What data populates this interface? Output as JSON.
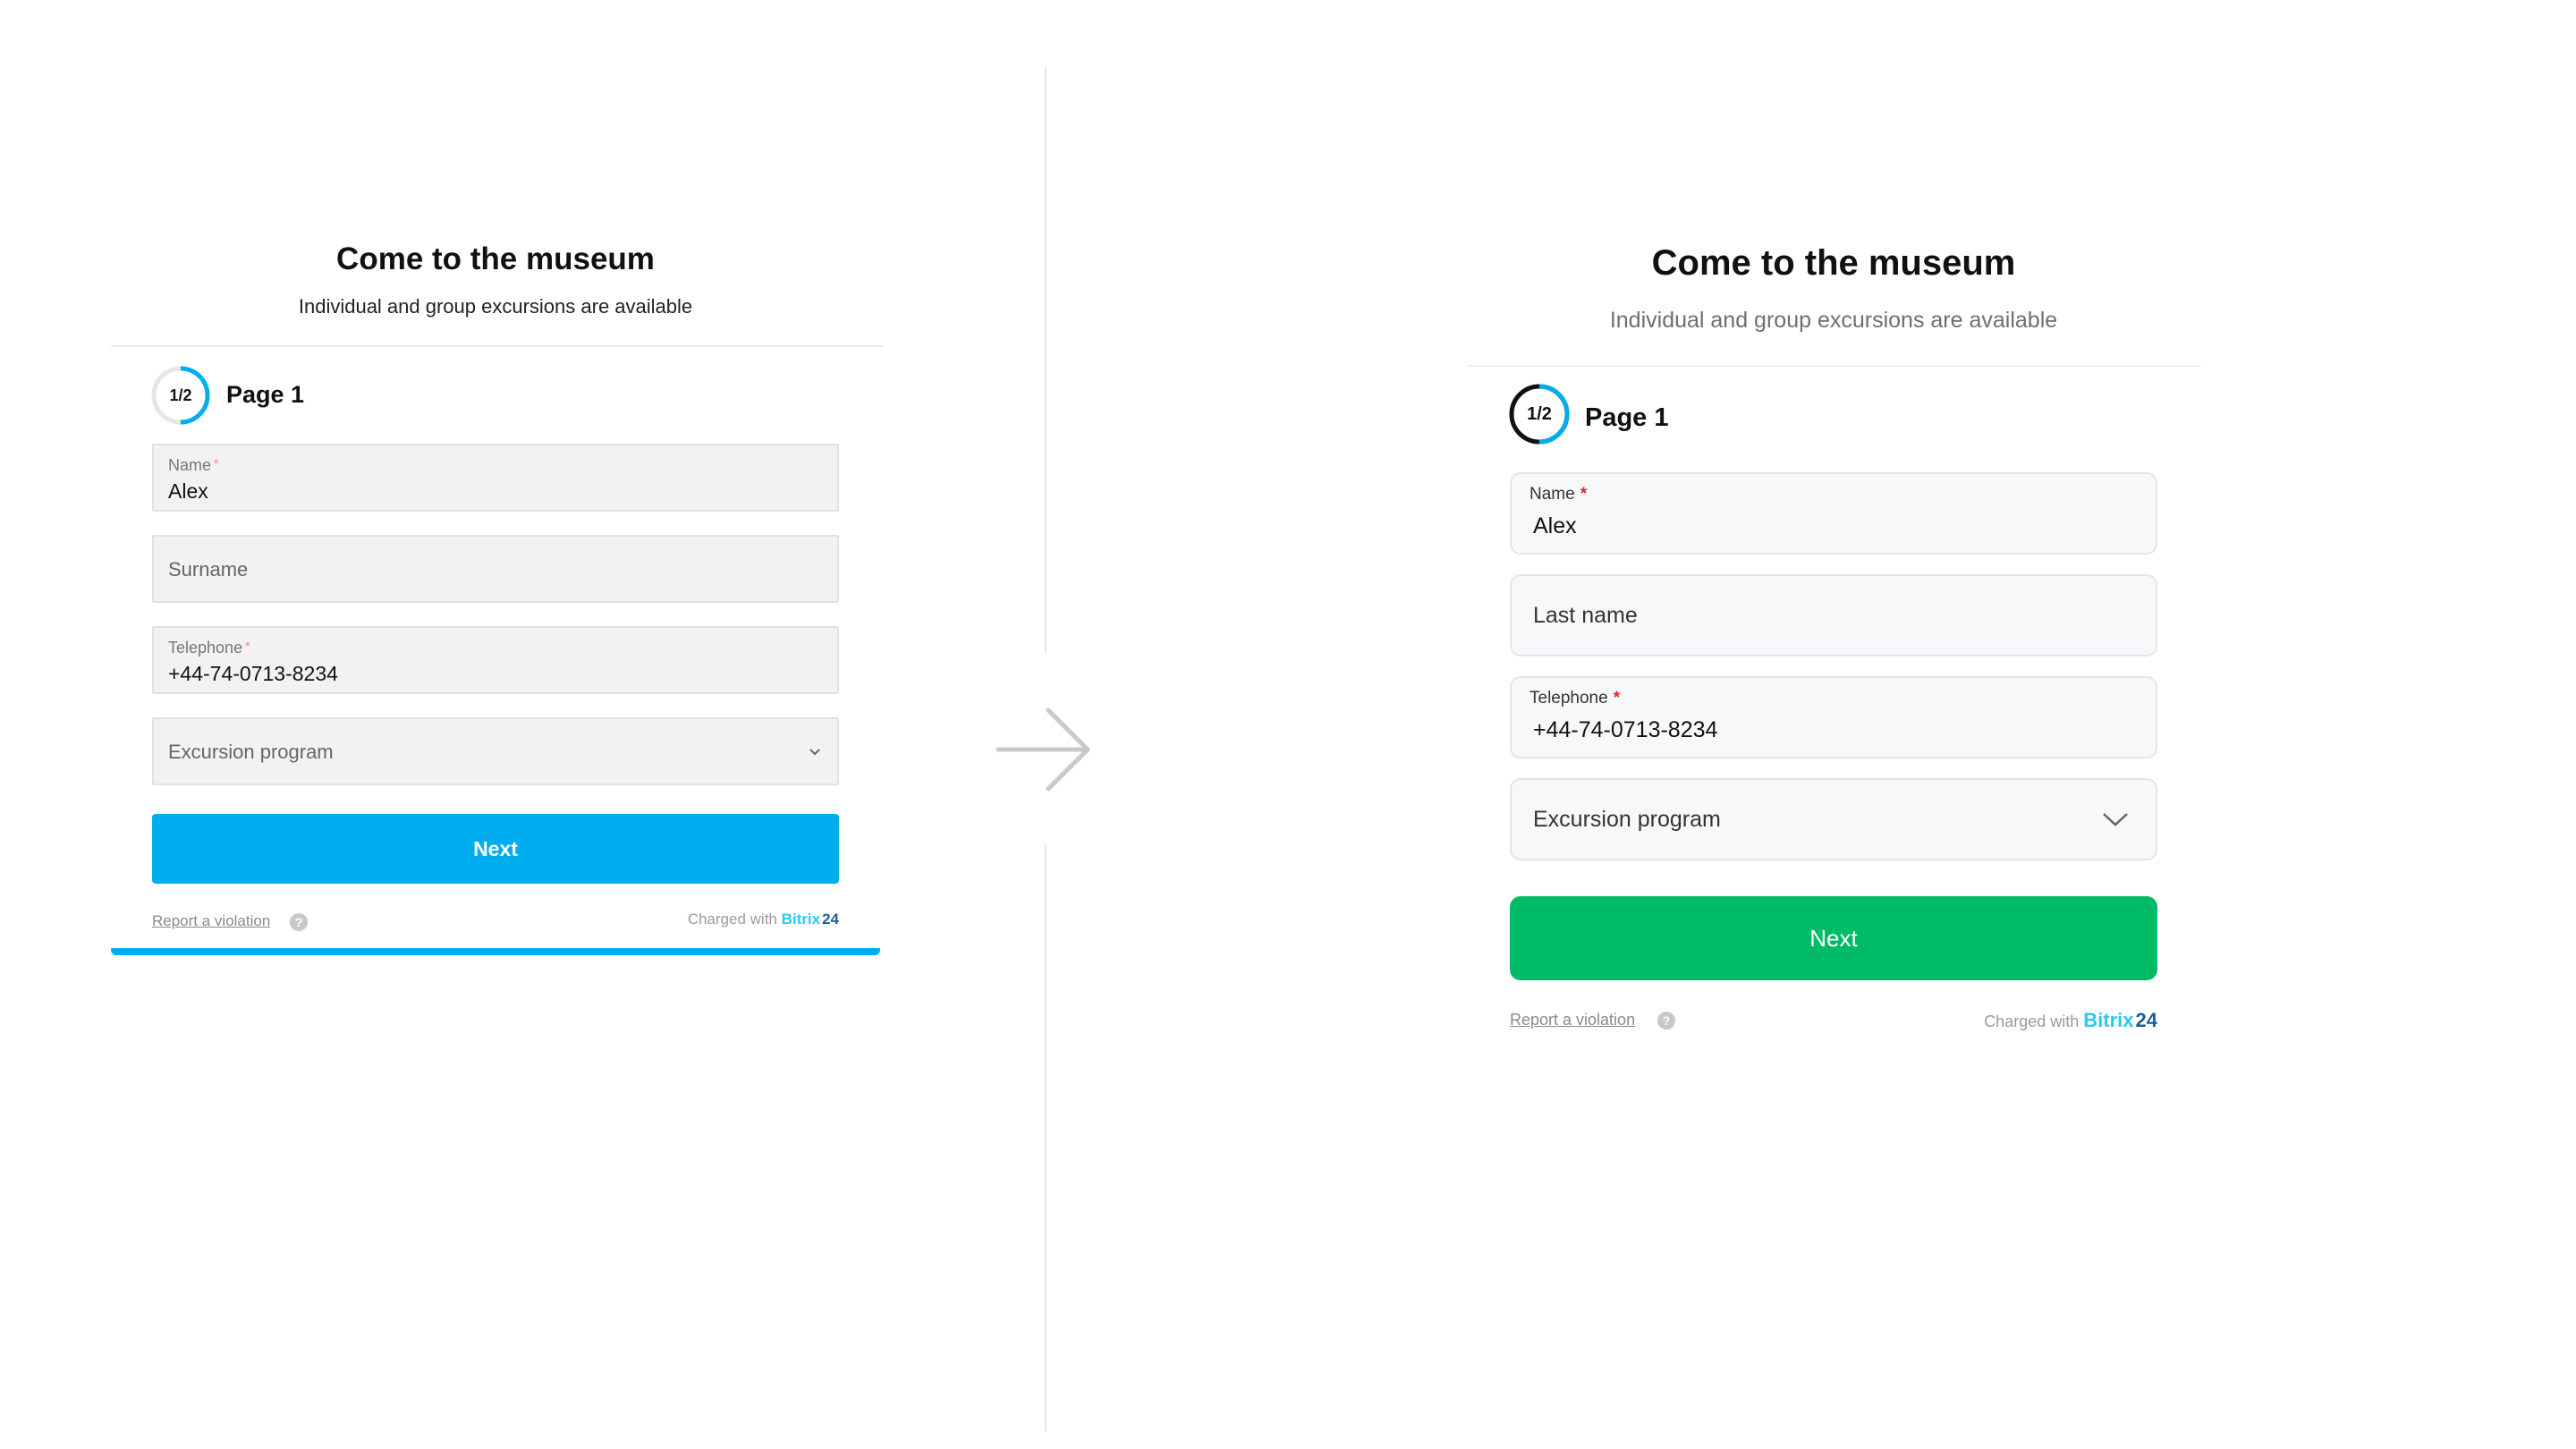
{
  "colors": {
    "old_accent": "#00aef0",
    "new_accent": "#00bb65",
    "progress_blue": "#00aef0",
    "bitrix_brand": "#2fc6f6",
    "bitrix_24": "#1c5e9c",
    "required_mark_new": "#e0262b"
  },
  "comparison": {
    "arrow_icon": "arrow-right-icon"
  },
  "old_form": {
    "title": "Come to the museum",
    "subtitle": "Individual and group excursions are available",
    "progress": {
      "text": "1/2",
      "fraction": 0.5
    },
    "page_label": "Page 1",
    "fields": {
      "name": {
        "label": "Name",
        "required_mark": "*",
        "value": "Alex"
      },
      "surname": {
        "placeholder": "Surname"
      },
      "telephone": {
        "label": "Telephone",
        "required_mark": "*",
        "value": "+44-74-0713-8234"
      },
      "excursion": {
        "placeholder": "Excursion program",
        "icon": "chevron-down-icon"
      }
    },
    "next_label": "Next",
    "report_label": "Report a violation",
    "help_glyph": "?",
    "charged_prefix": "Charged with",
    "brand_name": "Bitrix",
    "brand_number": "24"
  },
  "new_form": {
    "title": "Come to the museum",
    "subtitle": "Individual and group excursions are available",
    "progress": {
      "text": "1/2",
      "fraction": 0.5
    },
    "page_label": "Page 1",
    "fields": {
      "name": {
        "label": "Name",
        "required_mark": "*",
        "value": "Alex"
      },
      "last_name": {
        "placeholder": "Last name"
      },
      "telephone": {
        "label": "Telephone",
        "required_mark": "*",
        "value": "+44-74-0713-8234"
      },
      "excursion": {
        "placeholder": "Excursion program",
        "icon": "chevron-down-icon"
      }
    },
    "next_label": "Next",
    "report_label": "Report a violation",
    "help_glyph": "?",
    "charged_prefix": "Charged with",
    "brand_name": "Bitrix",
    "brand_number": "24"
  }
}
